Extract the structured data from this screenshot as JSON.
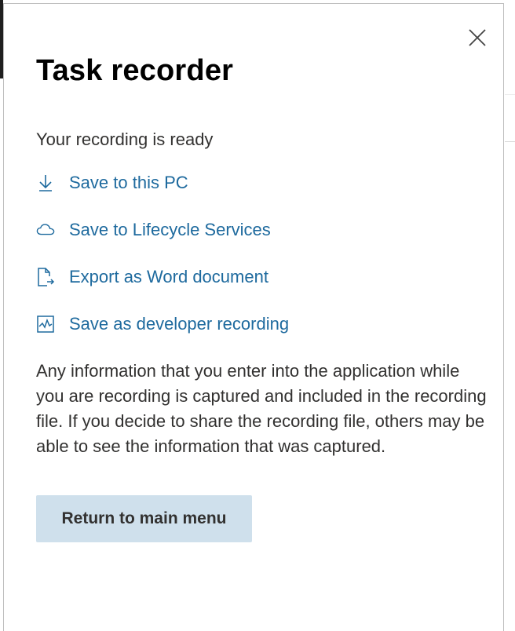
{
  "panel": {
    "title": "Task recorder",
    "status": "Your recording is ready",
    "actions": [
      {
        "label": "Save to this PC",
        "icon": "download-icon"
      },
      {
        "label": "Save to Lifecycle Services",
        "icon": "cloud-icon"
      },
      {
        "label": "Export as Word document",
        "icon": "export-document-icon"
      },
      {
        "label": "Save as developer recording",
        "icon": "developer-recording-icon"
      }
    ],
    "info_text": "Any information that you enter into the application while you are recording is captured and included in the recording file. If you decide to share the recording file, others may be able to see the information that was captured.",
    "return_button": "Return to main menu",
    "close_icon": "close-icon"
  },
  "colors": {
    "link": "#1e6a9e",
    "button_bg": "#cfe0ec",
    "text": "#323130",
    "title": "#000000"
  }
}
